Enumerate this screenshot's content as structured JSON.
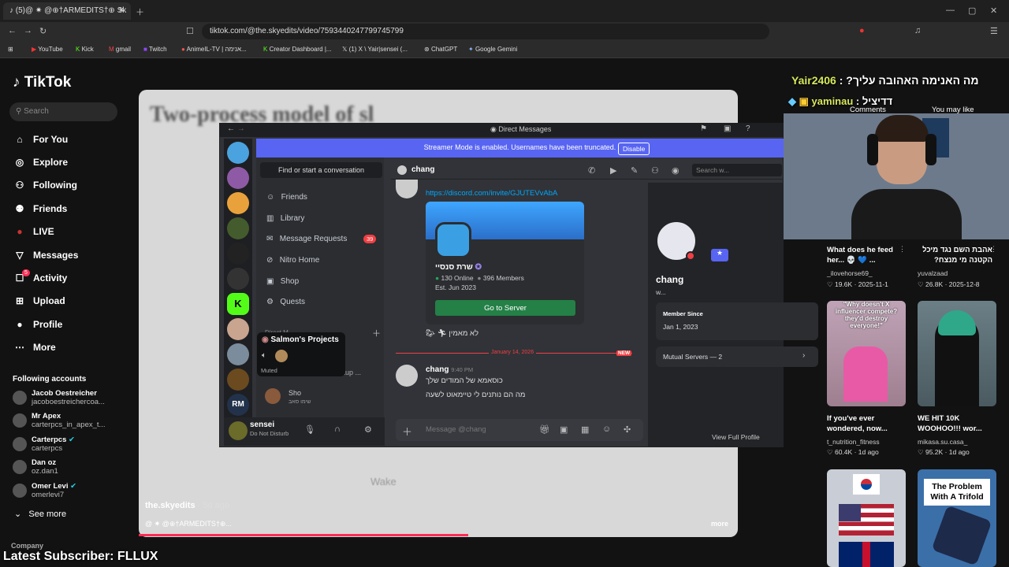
{
  "browser": {
    "tab_title": "(5)@ ✷ @⊕†ARMEDITS†⊕ Sk",
    "url": "tiktok.com/@the.skyedits/video/7593440247799745799",
    "bookmarks": [
      "YouTube",
      "Kick",
      "gmail",
      "Twitch",
      "AnimeIL-TV | אנימה...",
      "Creator Dashboard |...",
      "(1) X \\ Yair|sensei (...",
      "ChatGPT",
      "Google Gemini"
    ]
  },
  "tiktok": {
    "logo": "TikTok",
    "search_placeholder": "Search",
    "nav": [
      "For You",
      "Explore",
      "Following",
      "Friends",
      "LIVE",
      "Messages",
      "Activity",
      "Upload",
      "Profile",
      "More"
    ],
    "activity_badge": "5",
    "following_title": "Following accounts",
    "accounts": [
      {
        "name": "Jacob Oestreicher",
        "handle": "jacoboestreichercoa..."
      },
      {
        "name": "Mr Apex",
        "handle": "carterpcs_in_apex_t..."
      },
      {
        "name": "Carterpcs",
        "handle": "carterpcs"
      },
      {
        "name": "Dan oz",
        "handle": "oz.dan1"
      },
      {
        "name": "Omer Levi",
        "handle": "omerlevi7"
      }
    ],
    "see_more": "See more",
    "company": "Company",
    "video_title": "Two-process model of sl",
    "video_author": "the.skyedits",
    "video_time": "· 5d ago",
    "video_caption": "@ ✷ @⊕†ARMEDITS†⊕...",
    "video_more": "more",
    "video_word": "Wake",
    "tabs": [
      "Comments",
      "You may like"
    ]
  },
  "overlay": {
    "chat1_user": "Yair2406",
    "chat1_msg": "?מה האנימה האהובה עליך",
    "chat2_user": "yaminau",
    "chat2_msg": "דדיציל",
    "subscriber": "Latest Subscriber: FLLUX"
  },
  "discord": {
    "title": "Direct Messages",
    "streamer_msg": "Streamer Mode is enabled. Usernames have been truncated.",
    "disable": "Disable",
    "find": "Find or start a conversation",
    "menu": [
      "Friends",
      "Library",
      "Message Requests",
      "Nitro Home",
      "Shop",
      "Quests"
    ],
    "requests_badge": "39",
    "direct_messages_label": "Direct M",
    "tooltip": {
      "title": "Salmon's Projects",
      "muted": "Muted"
    },
    "dm_backup": "ackup ...",
    "dm_sho": "Sho",
    "dm_sho_sub": "שימו סאב",
    "user": {
      "name": "sensei",
      "status": "Do Not Disturb"
    },
    "chat_name": "chang",
    "search_placeholder": "Search w...",
    "invite_link": "https://discord.com/invite/GJUTEVvAbA",
    "invite": {
      "server": "שרת סנסיי",
      "online": "130 Online",
      "members": "396 Members",
      "est": "Est. Jun 2023",
      "button": "Go to Server"
    },
    "reaction_text": "לא מאמין",
    "date_divider": "January 14, 2026",
    "new_label": "NEW",
    "msg_author": "chang",
    "msg_time": "9:40 PM",
    "msg_line1": "כוסאמא של המודים שלך",
    "msg_line2": "מה הם נותנים לי טיימאוט לשעה",
    "composer_placeholder": "Message @chang",
    "profile": {
      "name": "chang",
      "sub": "w...",
      "member_since_label": "Member Since",
      "member_since": "Jan 1, 2023",
      "mutual": "Mutual Servers — 2",
      "view_full": "View Full Profile"
    }
  },
  "feed": [
    {
      "text": "What does he feed her... 💀 💙 ...",
      "user": "_ilovehorse69_",
      "likes": "♡ 19.6K",
      "date": "2025-11-1"
    },
    {
      "text": "אהבת השם נגד מיכל הקטנה מי מנצח?",
      "user": "yuvalzaad",
      "likes": "♡ 26.8K",
      "date": "2025-12-8"
    },
    {
      "text": "If you've ever wondered, now...",
      "user": "t_nutrition_fitness",
      "likes": "♡ 60.4K",
      "date": "1d ago",
      "thumb": "\"Why doesn't X influencer compete? they'd destroy everyone!\""
    },
    {
      "text": "WE HIT 10K WOOHOO!!! wor...",
      "user": "mikasa.su.casa_",
      "likes": "♡ 95.2K",
      "date": "1d ago"
    },
    {
      "thumb": "The Problem With A Trifold"
    }
  ]
}
